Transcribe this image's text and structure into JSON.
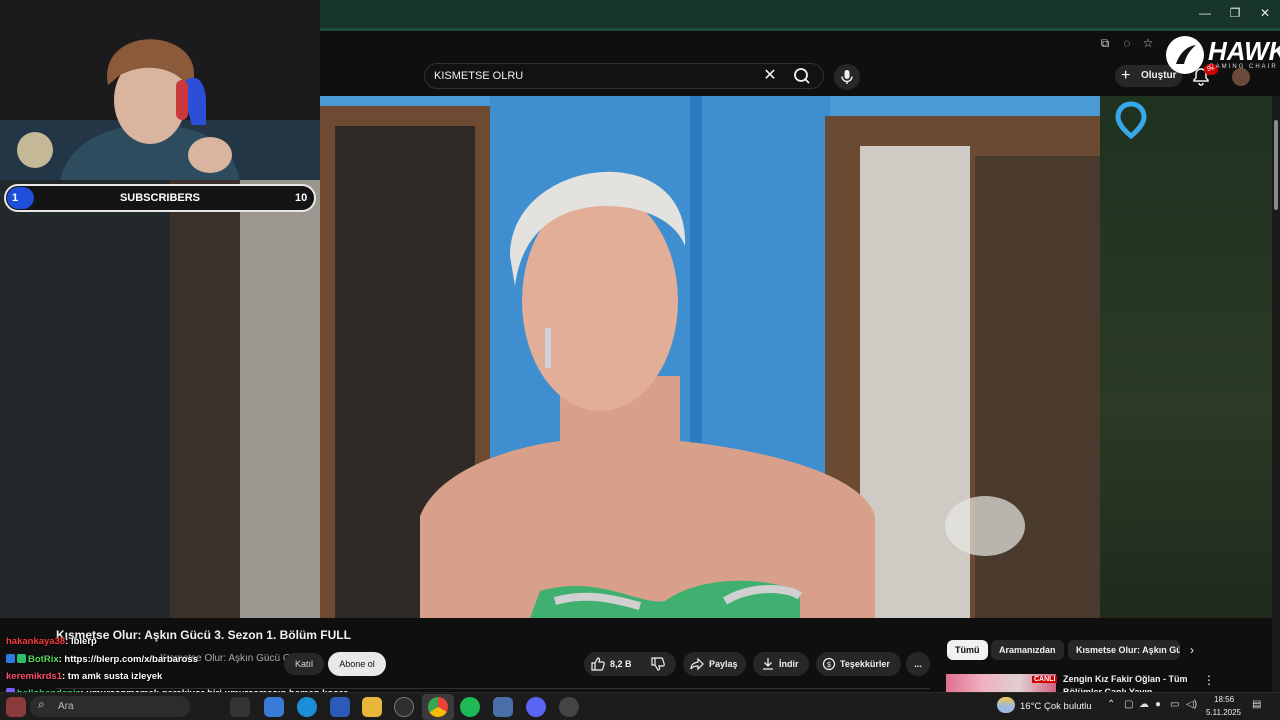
{
  "overlay": {
    "subscribers_current": "1",
    "subscribers_label": "SUBSCRIBERS",
    "subscribers_goal": "10",
    "subscribers_progress": 0.1
  },
  "brand": {
    "name": "HAWK",
    "tagline": "GAMING CHAIR"
  },
  "search": {
    "value": "KISMETSE OLRU",
    "clear_label": "✕"
  },
  "header": {
    "create_label": "Oluştur",
    "notifications_count": "9+"
  },
  "video": {
    "title": "Kısmetse Olur: Aşkın Gücü 3. Sezon 1. Bölüm FULL",
    "channel": "Kısmetse Olur: Aşkın Gücü Official",
    "join_label": "Katıl",
    "subscribe_label": "Abone ol",
    "likes": "8,2 B",
    "share_label": "Paylaş",
    "download_label": "İndir",
    "thanks_label": "Teşekkürler",
    "more_label": "..."
  },
  "chips": [
    "Tümü",
    "Aramanızdan",
    "Kısmetse Olur: Aşkın Gücü"
  ],
  "recommendation": {
    "title": "Zengin Kız Fakir Oğlan - Tüm Bölümler Canlı Yayın",
    "live_badge": "CANLI"
  },
  "chat": [
    {
      "user": "hakankaya38",
      "message": ": lblerp",
      "color": "#ff3b3b",
      "badge": ""
    },
    {
      "user": "BotRix",
      "message": ": https://blerp.com/x/barbaross",
      "color": "#57d657",
      "badge": "bot"
    },
    {
      "user": "keremikrds1",
      "message": ": tm amk susta izleyek",
      "color": "#ff4d6d",
      "badge": ""
    },
    {
      "user": "hellobendeniz",
      "message": ": umursanmamak gerekiyor biri umursamasın hemen koşar",
      "color": "#3fd27a",
      "badge": "sub"
    }
  ],
  "taskbar": {
    "search_placeholder": "Ara",
    "temperature": "16°C",
    "weather": "Çok bulutlu",
    "time": "18:56",
    "date": "5.11.2025"
  },
  "colors": {
    "titlebar": "#173529",
    "youtube_bg": "#0f0f0f",
    "subscriber_fill": "#1f4fd8",
    "live_red": "#cc0000"
  }
}
